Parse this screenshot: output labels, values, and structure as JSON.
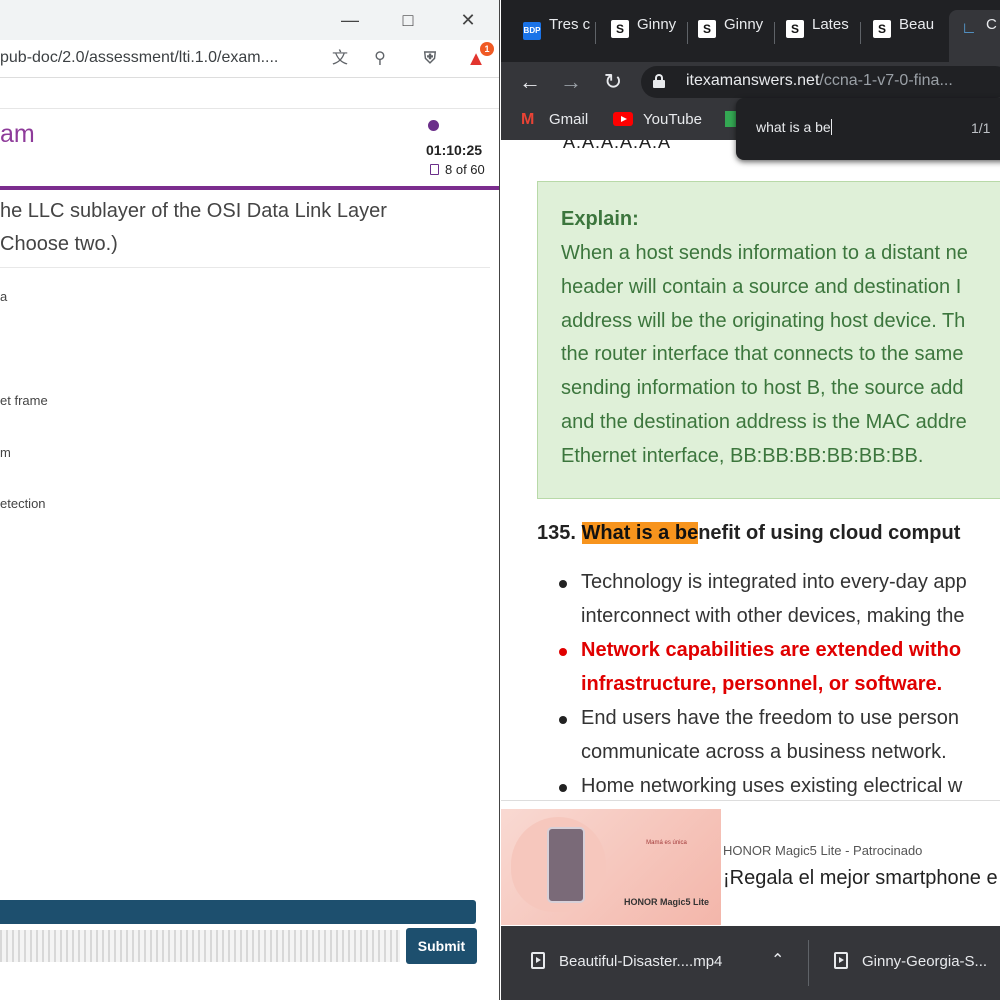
{
  "left_window": {
    "url": "pub-doc/2.0/assessment/lti.1.0/exam....",
    "exam_title": "am",
    "timer": "01:10:25",
    "progress": "8 of 60",
    "extension_badge": "1",
    "question_line1": "he LLC sublayer of the OSI Data Link Layer",
    "question_line2": "Choose two.)",
    "options": [
      "a",
      "et frame",
      "m",
      "etection"
    ],
    "submit_label": "Submit"
  },
  "right_window": {
    "tabs": [
      {
        "label": "Tres c",
        "icon": "bdp-icon"
      },
      {
        "label": "Ginny",
        "icon": "s-icon"
      },
      {
        "label": "Ginny",
        "icon": "s-icon"
      },
      {
        "label": "Lates",
        "icon": "s-icon"
      },
      {
        "label": "Beau",
        "icon": "s-icon"
      },
      {
        "label": "C",
        "icon": "cisco-icon"
      }
    ],
    "url_domain": "itexamanswers.net",
    "url_path": "/ccna-1-v7-0-fina...",
    "bookmarks": [
      {
        "label": "Gmail",
        "icon": "gmail-icon"
      },
      {
        "label": "YouTube",
        "icon": "youtube-icon"
      }
    ],
    "find": {
      "query": "what is a be",
      "count": "1/1"
    },
    "prev_line": "A:A:A:A:A:A",
    "explain": {
      "title": "Explain:",
      "lines": [
        "When a host sends information to a distant ne",
        "header will contain a source and destination I",
        "address will be the originating host device. Th",
        "the router interface that connects to the same",
        "sending information to host B, the source add",
        "and the destination address is the MAC addre",
        "Ethernet interface, BB:BB:BB:BB:BB:BB."
      ]
    },
    "question": {
      "number": "135.",
      "highlight": "What is a be",
      "rest": "nefit of using cloud comput"
    },
    "answers": [
      {
        "line1": "Technology is integrated into every-day app",
        "line2": "interconnect with other devices, making the",
        "correct": false
      },
      {
        "line1": "Network capabilities are extended witho",
        "line2": "infrastructure, personnel, or software.",
        "correct": true
      },
      {
        "line1": "End users have the freedom to use person",
        "line2": "communicate across a business network.",
        "correct": false
      },
      {
        "line1": "Home networking uses existing electrical w",
        "line2": "",
        "correct": false
      }
    ],
    "ad": {
      "sponsor": "HONOR Magic5 Lite - Patrocinado",
      "headline": "¡Regala el mejor smartphone e",
      "image_text1": "Mamá es única",
      "image_text2": "HONOR Magic5 Lite"
    },
    "downloads": [
      {
        "label": "Beautiful-Disaster....mp4"
      },
      {
        "label": "Ginny-Georgia-S..."
      }
    ]
  }
}
